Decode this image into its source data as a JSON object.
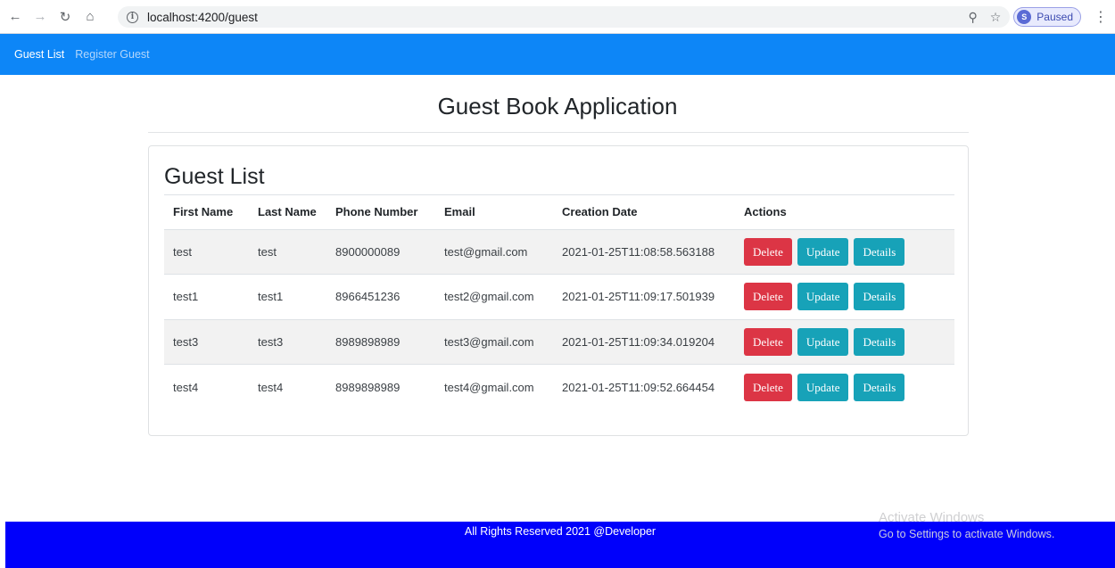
{
  "browser": {
    "url": "localhost:4200/guest",
    "profile_initial": "S",
    "profile_status": "Paused",
    "icons": {
      "back": "back-arrow-icon",
      "forward": "forward-arrow-icon",
      "reload": "reload-icon",
      "home": "home-icon",
      "info": "info-icon",
      "zoom": "zoom-icon",
      "star": "bookmark-star-icon",
      "menu": "kebab-menu-icon"
    }
  },
  "navbar": {
    "items": [
      {
        "label": "Guest List",
        "active": true
      },
      {
        "label": "Register Guest",
        "active": false
      }
    ],
    "color": "#0d86f7"
  },
  "page": {
    "title": "Guest Book Application"
  },
  "guest_list": {
    "title": "Guest List",
    "columns": [
      "First Name",
      "Last Name",
      "Phone Number",
      "Email",
      "Creation Date",
      "Actions"
    ],
    "rows": [
      {
        "first_name": "test",
        "last_name": "test",
        "phone": "8900000089",
        "email": "test@gmail.com",
        "created": "2021-01-25T11:08:58.563188"
      },
      {
        "first_name": "test1",
        "last_name": "test1",
        "phone": "8966451236",
        "email": "test2@gmail.com",
        "created": "2021-01-25T11:09:17.501939"
      },
      {
        "first_name": "test3",
        "last_name": "test3",
        "phone": "8989898989",
        "email": "test3@gmail.com",
        "created": "2021-01-25T11:09:34.019204"
      },
      {
        "first_name": "test4",
        "last_name": "test4",
        "phone": "8989898989",
        "email": "test4@gmail.com",
        "created": "2021-01-25T11:09:52.664454"
      }
    ],
    "actions": {
      "delete": "Delete",
      "update": "Update",
      "details": "Details"
    },
    "colors": {
      "delete": "#dc3545",
      "update": "#17a2b8",
      "details": "#17a2b8"
    }
  },
  "footer": {
    "text": "All Rights Reserved 2021 @Developer",
    "color": "#0000fb"
  },
  "watermark": {
    "line1": "Activate Windows",
    "line2": "Go to Settings to activate Windows."
  }
}
